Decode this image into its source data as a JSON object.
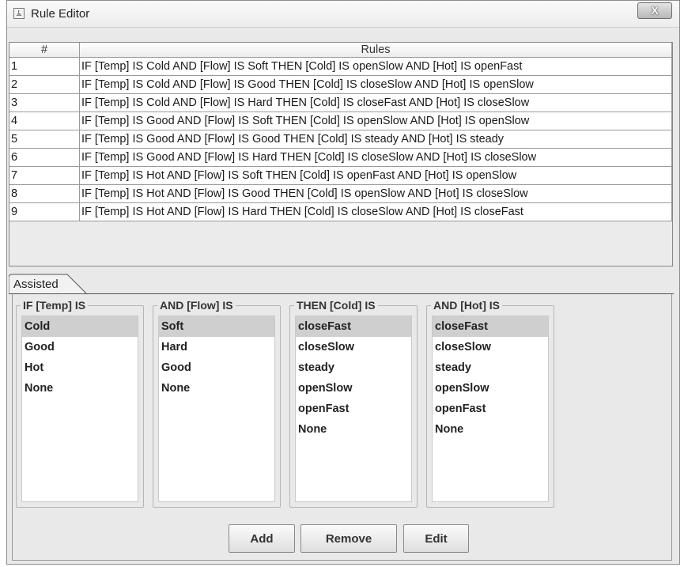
{
  "window": {
    "title": "Rule Editor",
    "close_label": "X"
  },
  "table": {
    "headers": [
      "#",
      "Rules"
    ],
    "rows": [
      [
        "1",
        "IF [Temp] IS Cold AND [Flow] IS Soft THEN [Cold] IS openSlow AND [Hot] IS openFast"
      ],
      [
        "2",
        "IF [Temp] IS Cold AND [Flow] IS Good THEN [Cold] IS closeSlow AND [Hot] IS openSlow"
      ],
      [
        "3",
        "IF [Temp] IS Cold AND [Flow] IS Hard THEN [Cold] IS closeFast AND [Hot] IS closeSlow"
      ],
      [
        "4",
        "IF [Temp] IS Good AND [Flow] IS Soft THEN [Cold] IS openSlow AND [Hot] IS openSlow"
      ],
      [
        "5",
        "IF [Temp] IS Good AND [Flow] IS Good THEN [Cold] IS steady AND [Hot] IS steady"
      ],
      [
        "6",
        "IF [Temp] IS Good AND [Flow] IS Hard THEN [Cold] IS closeSlow AND [Hot] IS closeSlow"
      ],
      [
        "7",
        "IF [Temp] IS Hot AND [Flow] IS Soft THEN [Cold] IS openFast AND [Hot] IS openSlow"
      ],
      [
        "8",
        "IF [Temp] IS Hot AND [Flow] IS Good THEN [Cold] IS openSlow AND [Hot] IS closeSlow"
      ],
      [
        "9",
        "IF [Temp] IS Hot AND [Flow] IS Hard THEN [Cold] IS closeSlow AND [Hot] IS closeFast"
      ]
    ]
  },
  "tabs": [
    {
      "label": "Assisted"
    }
  ],
  "groups": [
    {
      "title": "IF [Temp] IS",
      "items": [
        "Cold",
        "Good",
        "Hot",
        "None"
      ],
      "selected": 0
    },
    {
      "title": "AND [Flow] IS",
      "items": [
        "Soft",
        "Hard",
        "Good",
        "None"
      ],
      "selected": 0
    },
    {
      "title": "THEN [Cold] IS",
      "items": [
        "closeFast",
        "closeSlow",
        "steady",
        "openSlow",
        "openFast",
        "None"
      ],
      "selected": 0
    },
    {
      "title": "AND [Hot] IS",
      "items": [
        "closeFast",
        "closeSlow",
        "steady",
        "openSlow",
        "openFast",
        "None"
      ],
      "selected": 0
    }
  ],
  "buttons": {
    "add": "Add",
    "remove": "Remove",
    "edit": "Edit"
  }
}
